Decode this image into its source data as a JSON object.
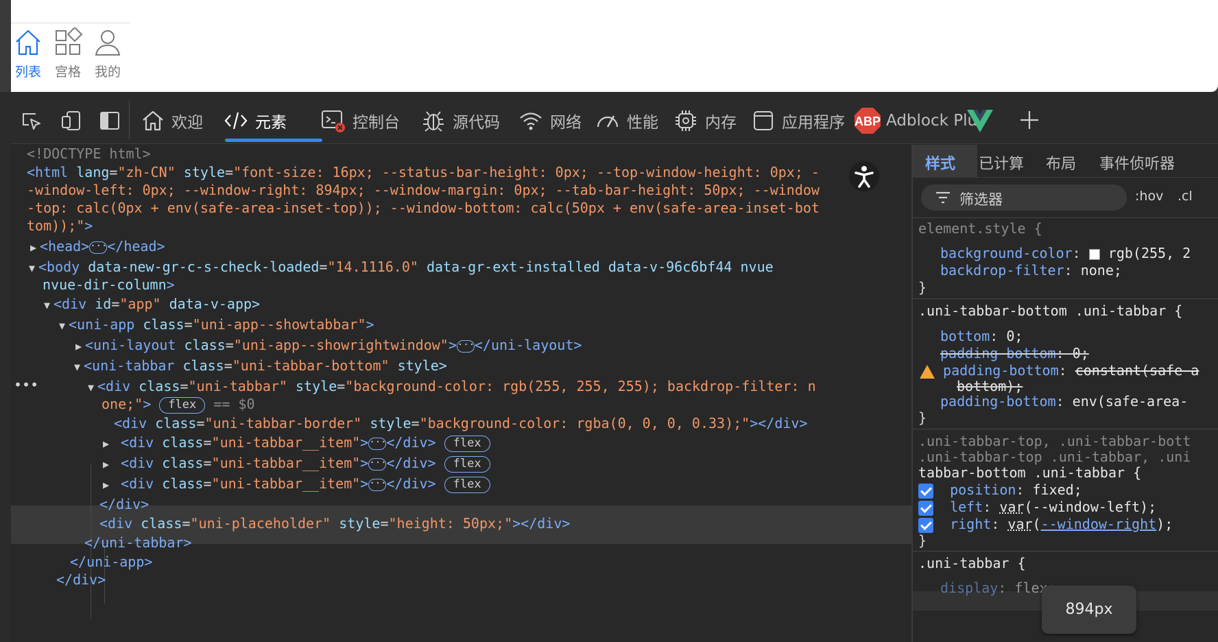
{
  "preview": {
    "tabs": [
      {
        "label": "列表",
        "icon": "home-icon",
        "active": true
      },
      {
        "label": "宫格",
        "icon": "grid-icon",
        "active": false
      },
      {
        "label": "我的",
        "icon": "user-icon",
        "active": false
      }
    ]
  },
  "toolbar": {
    "tabs": [
      {
        "label": "欢迎",
        "icon": "home-icon"
      },
      {
        "label": "元素",
        "icon": "code-icon"
      },
      {
        "label": "控制台",
        "icon": "console-icon"
      },
      {
        "label": "源代码",
        "icon": "bug-icon"
      },
      {
        "label": "网络",
        "icon": "wifi-icon"
      },
      {
        "label": "性能",
        "icon": "gauge-icon"
      },
      {
        "label": "内存",
        "icon": "chip-icon"
      },
      {
        "label": "应用程序",
        "icon": "app-icon"
      },
      {
        "label": "Adblock Plus",
        "icon": "abp-icon"
      }
    ],
    "abp_text": "ABP",
    "accent": "#3b82f6"
  },
  "elements": {
    "doctype": "<!DOCTYPE html>",
    "html_open_1": "<html ",
    "html_attr_lang": "lang",
    "html_val_lang": "\"zh-CN\"",
    "html_attr_style": " style",
    "html_val_style_1": "\"font-size: 16px; --status-bar-height: 0px; --top-window-height: 0px; -",
    "html_val_style_2": "-window-left: 0px; --window-right: 894px; --window-margin: 0px; --tab-bar-height: 50px; --window",
    "html_val_style_3": "-top: calc(0px + env(safe-area-inset-top)); --window-bottom: calc(50px + env(safe-area-inset-bot",
    "html_val_style_4": "tom));\"",
    "html_close_bracket": ">",
    "head_open": "<head>",
    "head_close": "</head>",
    "body_open": "<body ",
    "body_attr_1": "data-new-gr-c-s-check-loaded",
    "body_val_1": "\"14.1116.0\"",
    "body_attr_rest_1": " data-gr-ext-installed data-v-96c6bf44 nvue",
    "body_attr_rest_2": "nvue-dir-column",
    "div_app_open": "<div ",
    "div_app_attr": "id",
    "div_app_val": "\"app\"",
    "div_app_rest": " data-v-app>",
    "uniapp_open": "<uni-app ",
    "uniapp_attr": "class",
    "uniapp_val": "\"uni-app--showtabbar\"",
    "unilayout_open": "<uni-layout ",
    "unilayout_val": "\"uni-app--showrightwindow\"",
    "unilayout_close": "</uni-layout>",
    "unitabbar_open": "<uni-tabbar ",
    "unitabbar_val": "\"uni-tabbar-bottom\"",
    "unitabbar_rest": " style>",
    "sel_div_open": "<div ",
    "sel_div_class": "\"uni-tabbar\"",
    "sel_div_style_1": "\"background-color: rgb(255, 255, 255); backdrop-filter: n",
    "sel_div_style_2": "one;\"",
    "sel_marker": "== $0",
    "border_div_class": "\"uni-tabbar-border\"",
    "border_div_style": "\"background-color: rgba(0, 0, 0, 0.33);\"",
    "border_div_close": "></div>",
    "item_class": "\"uni-tabbar__item\"",
    "div_close": "</div>",
    "placeholder_class": "\"uni-placeholder\"",
    "placeholder_style": "\"height: 50px;\"",
    "unitabbar_close": "</uni-tabbar>",
    "uniapp_close": "</uni-app>",
    "last_div_close": "</div>",
    "flex_badge": "flex",
    "attr_class": "class",
    "attr_style": "style",
    "row_dots": "•••"
  },
  "styles": {
    "tabs": [
      "样式",
      "已计算",
      "布局",
      "事件侦听器"
    ],
    "filter_placeholder": "筛选器",
    "hov_button": ":hov",
    "cls_button": ".cl",
    "rule1_selector": "element.style {",
    "rule1_p1": "background-color",
    "rule1_v1": "rgb(255, 2",
    "rule1_p2": "backdrop-filter",
    "rule1_v2": "none;",
    "rule_close": "}",
    "rule2_selector": ".uni-tabbar-bottom .uni-tabbar {",
    "rule2_p1": "bottom",
    "rule2_v1": "0;",
    "rule2_p2": "padding-bottom",
    "rule2_v2": "0;",
    "rule2_p3": "padding-bottom",
    "rule2_v3a": "constant(safe-a",
    "rule2_v3b": "bottom);",
    "rule2_p4": "padding-bottom",
    "rule2_v4": "env(safe-area-",
    "rule3_sel_1": ".uni-tabbar-top, .uni-tabbar-bott",
    "rule3_sel_2": ".uni-tabbar-top .uni-tabbar, .uni",
    "rule3_sel_3": "tabbar-bottom .uni-tabbar {",
    "rule3_p1": "position",
    "rule3_v1": "fixed;",
    "rule3_p2": "left",
    "rule3_v2a": "var",
    "rule3_v2b": "(--window-left);",
    "rule3_p3": "right",
    "rule3_v3a": "var",
    "rule3_v3b": "(",
    "rule3_v3c": "--window-right",
    "rule3_v3d": ");",
    "rule4_selector": ".uni-tabbar {",
    "rule4_p1": "display",
    "rule4_v1": "flex;",
    "tooltip": "894px"
  }
}
